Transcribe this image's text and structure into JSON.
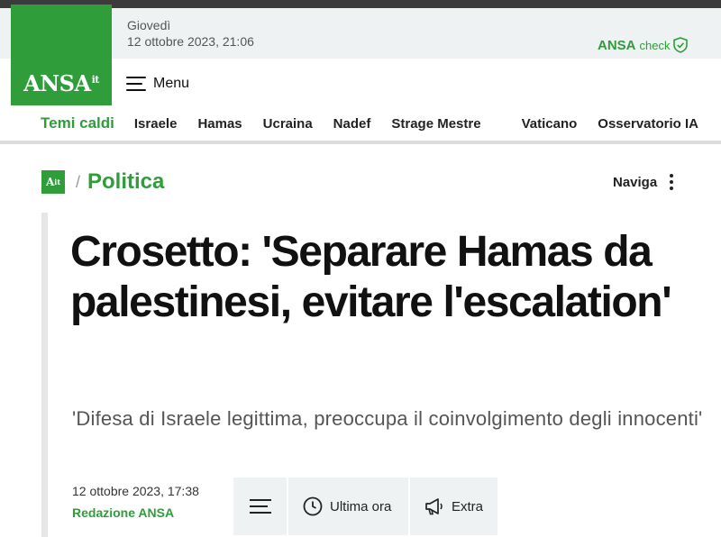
{
  "header": {
    "day": "Giovedì",
    "datetime": "12 ottobre 2023, 21:06",
    "logo_text": "ANSA",
    "logo_sup": "it",
    "ansacheck_brand": "ANSA",
    "ansacheck_suffix": "check",
    "menu_label": "Menu"
  },
  "nav": {
    "hot_label": "Temi caldi",
    "items": [
      "Israele",
      "Hamas",
      "Ucraina",
      "Nadef",
      "Strage Mestre",
      "Vaticano",
      "Osservatorio IA"
    ]
  },
  "breadcrumb": {
    "logo_text": "A",
    "logo_sup": "it",
    "separator": "/",
    "section": "Politica",
    "naviga_label": "Naviga"
  },
  "article": {
    "headline": "Crosetto: 'Separare Hamas da palestinesi, evitare l'escalation'",
    "subtitle": "'Difesa di Israele legittima, preoccupa il coinvolgimento degli innocenti'",
    "date": "12 ottobre 2023, 17:38",
    "author": "Redazione ANSA"
  },
  "toolbar": {
    "ultima_ora": "Ultima ora",
    "extra": "Extra"
  },
  "colors": {
    "brand_green": "#2e9d3a",
    "bar_gray": "#eef2f3"
  },
  "icons": [
    "hamburger-icon",
    "shield-check-icon",
    "kebab-menu-icon",
    "clock-icon",
    "megaphone-icon"
  ]
}
